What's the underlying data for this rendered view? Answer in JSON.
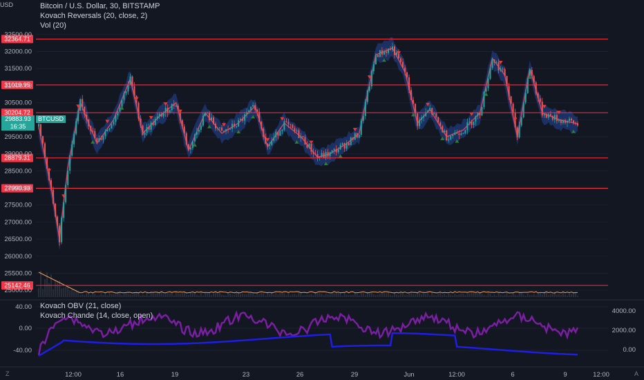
{
  "currency_label": "USD",
  "legend": {
    "main": "Bitcoin / U.S. Dollar, 30, BITSTAMP",
    "ind1": "Kovach Reversals (20, close, 2)",
    "ind2": "Vol (20)",
    "obv": "Kovach OBV (21, close)",
    "chande": "Kovach Chande (14, close, open)"
  },
  "price_axis": {
    "min": 24800,
    "max": 32800,
    "ticks": [
      "32500.00",
      "32000.00",
      "31500.00",
      "31000.00",
      "30500.00",
      "30000.00",
      "29500.00",
      "29000.00",
      "28500.00",
      "28000.00",
      "27500.00",
      "27000.00",
      "26500.00",
      "26000.00",
      "25500.00",
      "25000.00"
    ]
  },
  "hlines": [
    {
      "label": "32364.71",
      "value": 32364.71
    },
    {
      "label": "31019.95",
      "value": 31019.95
    },
    {
      "label": "30204.72",
      "value": 30204.72
    },
    {
      "label": "28879.31",
      "value": 28879.31
    },
    {
      "label": "27990.99",
      "value": 27990.99
    },
    {
      "label": "25142.46",
      "value": 25142.46
    }
  ],
  "current": {
    "symbol": "BTCUSD",
    "price": "29883.93",
    "countdown": "16:35"
  },
  "osc_left_ticks": [
    "40.00",
    "0.00",
    "-40.00"
  ],
  "osc_right_ticks": [
    "4000.00",
    "2000.00",
    "0.00"
  ],
  "time_ticks": [
    "12:00",
    "16",
    "19",
    "23",
    "26",
    "29",
    "Jun",
    "12:00",
    "6",
    "9",
    "12:00"
  ],
  "corner_left": "Z",
  "corner_right": "A",
  "colors": {
    "bg": "#131722",
    "hline": "#f23645",
    "up": "#26a69a",
    "down": "#ef5350",
    "band": "#1f3a7a",
    "obv": "#7b1fa2",
    "chande": "#1e1ee6"
  }
}
